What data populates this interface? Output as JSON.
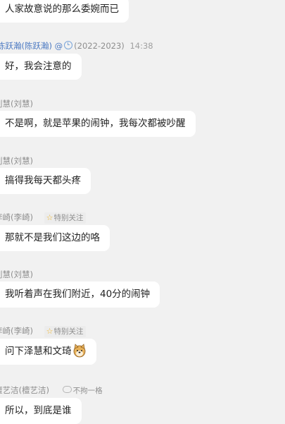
{
  "messages": [
    {
      "id": "m0",
      "sender": "",
      "text": "人家故意说的那么委婉而已"
    },
    {
      "id": "m1",
      "sender": "陈跃瀚(陈跃瀚)",
      "at": "@",
      "term": "(2022-2023)",
      "time": "14:38",
      "text": "好，我会注意的"
    },
    {
      "id": "m2",
      "sender": "刘慧(刘慧)",
      "text": "不是啊，就是苹果的闹钟，我每次都被吵醒"
    },
    {
      "id": "m3",
      "sender": "刘慧(刘慧)",
      "text": "搞得我每天都头疼"
    },
    {
      "id": "m4",
      "sender": "李崎(李崎)",
      "tag_icon": "star-icon",
      "tag": "特别关注",
      "text": "那就不是我们这边的咯"
    },
    {
      "id": "m5",
      "sender": "刘慧(刘慧)",
      "text": "我听着声在我们附近，40分的闹钟"
    },
    {
      "id": "m6",
      "sender": "李崎(李崎)",
      "tag_icon": "star-icon",
      "tag": "特别关注",
      "text": "问下泽慧和文琦",
      "emoji": "doge-emoji"
    },
    {
      "id": "m7",
      "sender": "檀艺洁(檀艺洁)",
      "tag_icon": "speech-bubble-icon",
      "tag": "不拘一格",
      "text": "所以，到底是谁"
    }
  ],
  "colors": {
    "background": "#f1f1f1",
    "bubble": "#ffffff",
    "meta_text": "#8e8e8e",
    "highlight_name": "#4a78c2",
    "star": "#f0b429"
  }
}
